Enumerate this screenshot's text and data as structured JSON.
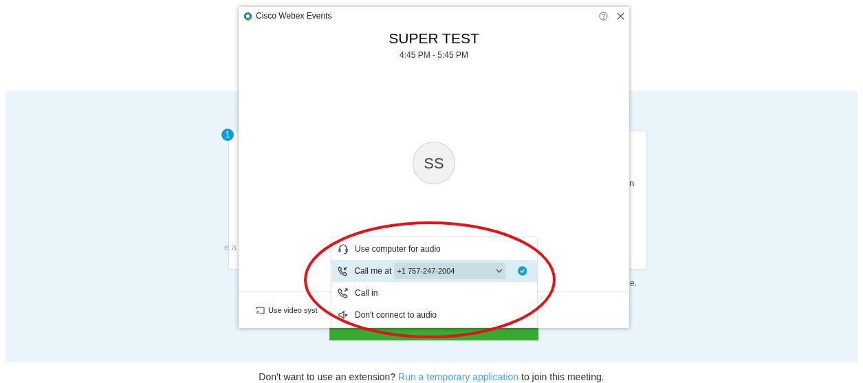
{
  "background": {
    "step_badge": "1",
    "fragments": [
      "e a",
      "n",
      "e."
    ],
    "footer": {
      "before": "Don't want to use an extension? ",
      "link": "Run a temporary application",
      "after": " to join this meeting."
    }
  },
  "dialog": {
    "title": "Cisco Webex Events",
    "meeting_title": "SUPER TEST",
    "time": "4:45 PM - 5:45 PM",
    "avatar": "SS",
    "video_system": "Use video syst"
  },
  "audio_menu": [
    {
      "kind": "computer",
      "label": "Use computer for audio",
      "selected": false
    },
    {
      "kind": "callme",
      "label": "Call me at",
      "number": "+1 757-247-2004",
      "selected": true
    },
    {
      "kind": "callin",
      "label": "Call in",
      "selected": false
    },
    {
      "kind": "none",
      "label": "Don't connect to audio",
      "selected": false
    }
  ]
}
